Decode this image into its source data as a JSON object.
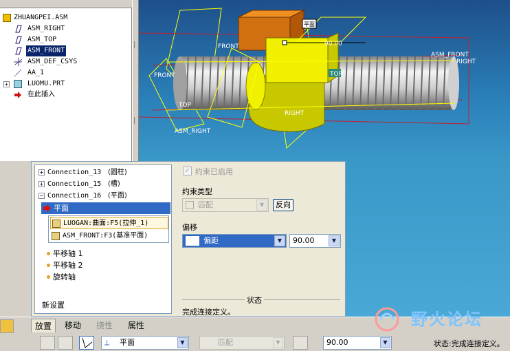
{
  "tree": {
    "root": "ZHUANGPEI.ASM",
    "items": [
      {
        "label": "ASM_RIGHT"
      },
      {
        "label": "ASM_TOP"
      },
      {
        "label": "ASM_FRONT"
      },
      {
        "label": "ASM_DEF_CSYS"
      },
      {
        "label": "AA_1"
      },
      {
        "label": "LUOMU.PRT"
      },
      {
        "label": "在此插入"
      }
    ],
    "colors": {
      "selected_bg": "#0a246a",
      "plane_icon": "#4a3b8a"
    }
  },
  "viewport": {
    "datum_labels": {
      "front_left": "FRONT",
      "front_top": "FRONT",
      "top_left": "TOP",
      "top_right": "TOP",
      "right_bottom": "RIGHT",
      "right_end": "RIGHT",
      "asm_right": "ASM_RIGHT",
      "asm_front": "ASM_FRONT",
      "dimension": "90.00",
      "tag": "平面"
    },
    "colors": {
      "bg_top": "#1e4f8a",
      "bg_bottom": "#3a98c8",
      "datum_yellow": "#ffff00",
      "datum_red": "#c02030",
      "part_orange": "#e08010",
      "part_yellow": "#f0f000"
    }
  },
  "placement": {
    "connections": [
      {
        "name": "Connection_13",
        "type": "(圆柱)"
      },
      {
        "name": "Connection_15",
        "type": "(槽)"
      },
      {
        "name": "Connection_16",
        "type": "(平面)"
      }
    ],
    "selected_constraint": "平面",
    "references": [
      "LUOGAN:曲面:F5(拉伸_1)",
      "ASM_FRONT:F3(基准平面)"
    ],
    "axes": [
      "平移轴 1",
      "平移轴 2",
      "旋转轴"
    ],
    "new_set": "新设置",
    "constraint_enabled": "约束已启用",
    "constraint_type_label": "约束类型",
    "constraint_type_value": "匹配",
    "flip_button": "反向",
    "offset_label": "偏移",
    "offset_type": "偏距",
    "offset_value": "90.00",
    "status_label": "状态",
    "status_text": "完成连接定义。"
  },
  "dashboard": {
    "tabs": [
      "放置",
      "移动",
      "挠性",
      "属性"
    ],
    "active_tab": "放置",
    "connection_type": "平面",
    "constraint_type": "匹配",
    "offset_value": "90.00",
    "status": "状态:完成连接定义。"
  },
  "watermark": "野火论坛"
}
